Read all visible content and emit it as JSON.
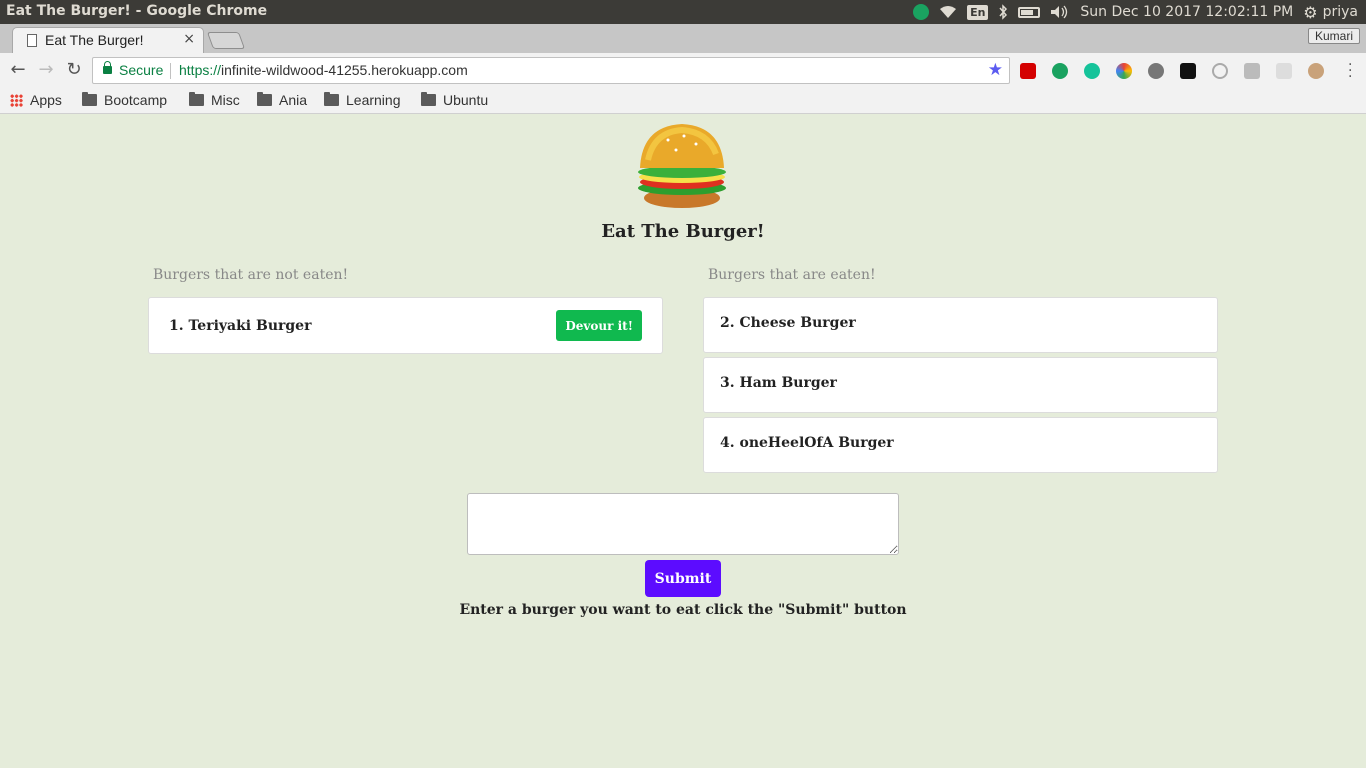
{
  "os": {
    "window_title": "Eat The Burger! - Google Chrome",
    "language": "En",
    "datetime": "Sun Dec 10 2017 12:02:11 PM",
    "user": "priya"
  },
  "browser": {
    "tab_title": "Eat The Burger!",
    "tab_close": "×",
    "profile": "Kumari",
    "secure_label": "Secure",
    "url_scheme": "https://",
    "url_rest": "infinite-wildwood-41255.herokuapp.com",
    "bookmarks": [
      "Apps",
      "Bootcamp",
      "Misc",
      "Ania",
      "Learning",
      "Ubuntu"
    ]
  },
  "page": {
    "title": "Eat The Burger!",
    "not_eaten_title": "Burgers that are not eaten!",
    "eaten_title": "Burgers that are eaten!",
    "not_eaten": [
      {
        "label": "1. Teriyaki Burger",
        "button": "Devour it!"
      }
    ],
    "eaten": [
      {
        "label": "2. Cheese Burger"
      },
      {
        "label": "3. Ham Burger"
      },
      {
        "label": "4. oneHeelOfA Burger"
      }
    ],
    "burger_input": {
      "value": "",
      "placeholder": ""
    },
    "submit_label": "Submit",
    "hint": "Enter a burger you want to eat click the \"Submit\" button"
  },
  "colors": {
    "page_bg": "#e5ecda",
    "devour_button": "#10b94f",
    "submit_button": "#5c0cff"
  }
}
